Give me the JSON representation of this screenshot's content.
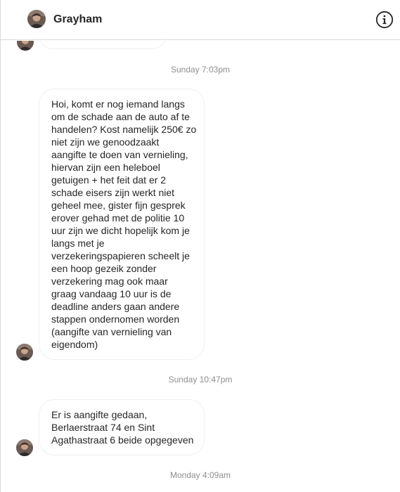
{
  "header": {
    "contact_name": "Grayham",
    "avatar_icon": "user-avatar-icon",
    "info_icon": "info-circle-icon"
  },
  "messages": [
    {
      "timestamp": "Sunday 7:03pm",
      "lines": [
        "Hoi, komt er nog iemand langs",
        "om de schade aan de auto af te",
        "handelen? Kost namelijk 250€ zo",
        "niet zijn we genoodzaakt",
        "aangifte te doen van vernieling,",
        "hiervan zijn een heleboel",
        "getuigen + het feit dat er 2",
        "schade eisers zijn werkt niet",
        "geheel mee, gister fijn gesprek",
        "erover gehad met de politie 10",
        "uur zijn we dicht hopelijk kom je",
        "langs met je",
        "verzekeringspapieren scheelt je",
        "een hoop gezeik zonder",
        "verzekering mag ook maar",
        "graag vandaag 10 uur is de",
        "deadline anders gaan andere",
        "stappen ondernomen worden",
        "(aangifte van vernieling van",
        "eigendom)"
      ]
    },
    {
      "timestamp": "Sunday 10:47pm",
      "lines": [
        "Er is aangifte gedaan,",
        "Berlaerstraat 74 en Sint",
        "Agathastraat 6 beide opgegeven"
      ]
    }
  ],
  "trailing_timestamp": "Monday 4:09am",
  "colors": {
    "text": "#262626",
    "timestamp": "#8e8e8e",
    "border": "#dbdbdb",
    "bubble_border": "#efefef"
  }
}
